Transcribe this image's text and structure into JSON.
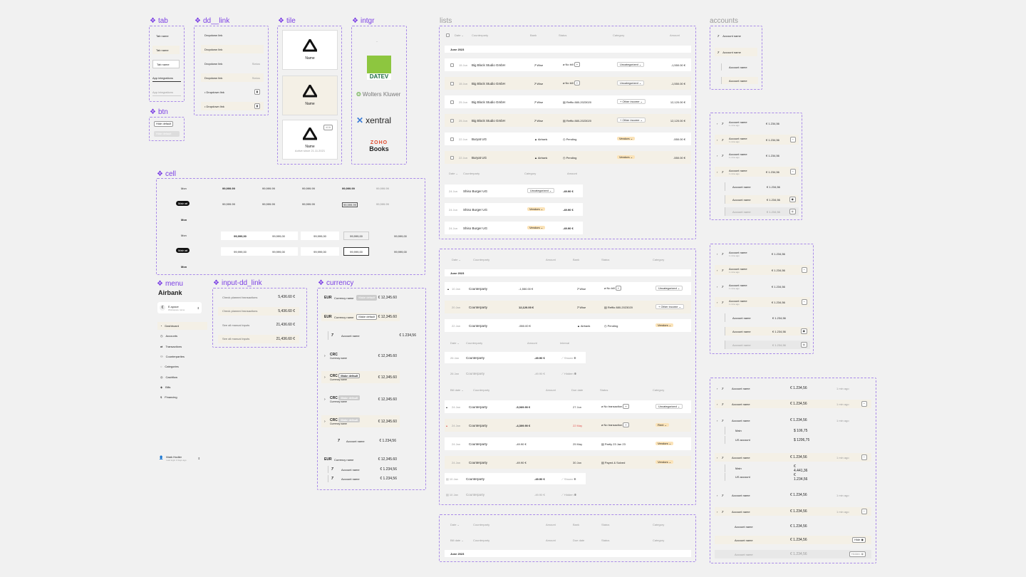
{
  "sections": {
    "tab": "tab",
    "dd_link": "dd__link",
    "tile": "tile",
    "intgr": "intgr",
    "btn": "btn",
    "cell": "cell",
    "menu": "menu",
    "input_dd_link": "input-dd_link",
    "currency": "currency",
    "lists": "lists",
    "accounts": "accounts"
  },
  "colors": {
    "accent": "#7b3fe4",
    "highlight": "#f4f0e6",
    "vendors": "#fbe3b8",
    "datev": "#8dc63f",
    "red": "#e25555"
  },
  "tab": {
    "items": [
      "Tab name",
      "Tab name",
      "Tab name",
      "App integrations",
      "App integrations"
    ]
  },
  "btn": {
    "primary": "Hide default",
    "secondary": "Hide default"
  },
  "dd_link": {
    "items": [
      "Dropdown link",
      "Dropdown link",
      "Dropdown link",
      "Dropdown link",
      "Dropdown link",
      "Dropdown link"
    ],
    "status": "Status"
  },
  "tile": {
    "name": "Name",
    "active_since": "Active since 21.11.2021"
  },
  "intgr": {
    "datev": "DATEV",
    "wolters": "Wolters Kluwer",
    "xentral": "xentral",
    "zoho_top": "ZOHO",
    "zoho_bottom": "Books"
  },
  "cell": {
    "label": "Mon",
    "pill": "Main",
    "value": "99,999.99",
    "big_value": "99,999,00"
  },
  "menu": {
    "logo": "Airbank",
    "workspace": "E-space",
    "workspace_sub": "Workspace name",
    "items": [
      "Dashboard",
      "Accounts",
      "Transactions",
      "Counterparties",
      "Categories",
      "Cashflow",
      "Bills",
      "Financing"
    ],
    "user": "Mark Hodler",
    "user_sub": "Last login 2 days ago"
  },
  "input_dd": {
    "items": [
      {
        "label": "Check planned transactions",
        "value": "5,436.60 €"
      },
      {
        "label": "Check planned transactions",
        "value": "5,436.60 €"
      },
      {
        "label": "See all manual inputs",
        "value": "21,436.60 €"
      },
      {
        "label": "See all manual inputs",
        "value": "21,436.60 €"
      }
    ]
  },
  "currency": {
    "eur": "EUR",
    "crc": "CRC",
    "currency_name": "Currency name",
    "account_name": "Account name",
    "make_default": "Make default",
    "amount": "€ 12,345.60",
    "acc_amount": "€ 1.234,56"
  },
  "lists": {
    "header": {
      "date": "Date",
      "counterparty": "Counterparty",
      "bank": "Bank",
      "status": "Status",
      "category": "Category",
      "amount": "Amount",
      "payment_date": "Payment date",
      "bill_date": "Bill date",
      "due_date": "Due date"
    },
    "month": "June 2023",
    "list1": [
      {
        "date": "15 Jun",
        "name": "Big Block Studio GmbH",
        "bank": "Wise",
        "status": "No bill",
        "category": "Uncategorized",
        "amount": "-1,550.00 €"
      },
      {
        "date": "15 Jun",
        "name": "Big Block Studio GmbH",
        "bank": "Wise",
        "status": "No bill",
        "category": "Uncategorized",
        "amount": "-1,550.00 €"
      },
      {
        "date": "25 Jun",
        "name": "Big Block Studio GmbH",
        "bank": "Wise",
        "status": "Refflo 880-2023020",
        "category": "+ Other income",
        "amount": "12,120.00 €"
      },
      {
        "date": "25 Jun",
        "name": "Big Block Studio GmbH",
        "bank": "Wise",
        "status": "Refflo 880-2023020",
        "category": "+ Other income",
        "amount": "12,120.00 €"
      },
      {
        "date": "22 Jun",
        "name": "Buryat UG",
        "bank": "Airbank",
        "status": "Pending",
        "category": "Vendors",
        "amount": "-550.00 €"
      },
      {
        "date": "22 Jun",
        "name": "Buryat UG",
        "bank": "Airbank",
        "status": "Pending",
        "category": "Vendors",
        "amount": "-550.00 €"
      }
    ],
    "list1b": [
      {
        "date": "24 Jun",
        "name": "Shiso Burger UG",
        "category": "Uncategorized",
        "amount": "-49.90 €"
      },
      {
        "date": "24 Jun",
        "name": "Shiso Burger UG",
        "category": "Vendors",
        "amount": "-49.90 €"
      },
      {
        "date": "24 Jun",
        "name": "Shiso Burger UG",
        "category": "Vendors",
        "amount": "-49.90 €"
      }
    ],
    "list2": [
      {
        "date": "10 Jan",
        "name": "Counterparty",
        "amount": "-1,550.00 €",
        "bank": "Wise",
        "status": "No bill",
        "category": "Uncategorized"
      },
      {
        "date": "20 Jan",
        "name": "Counterparty",
        "amount": "12,120.00 €",
        "bank": "Wise",
        "status": "Refflo 880-2023020",
        "category": "+ Other income"
      },
      {
        "date": "22 Jan",
        "name": "Counterparty",
        "amount": "-550.00 €",
        "bank": "Airbank",
        "status": "Pending",
        "category": "Vendors"
      }
    ],
    "list2b": [
      {
        "date": "26 Jan",
        "name": "Counterparty",
        "amount": "-49.90 €",
        "interval": "Shown"
      },
      {
        "date": "26 Jan",
        "name": "Counterparty",
        "amount": "-49.90 €",
        "interval": "Hidden"
      }
    ],
    "list2c": [
      {
        "date": "24 Jan",
        "name": "Counterparty",
        "amount": "-5,069.90 €",
        "due": "27 Jun",
        "status": "No transaction",
        "category": "Uncategorized"
      },
      {
        "date": "24 Jan",
        "name": "Counterparty",
        "amount": "-4,309.90 €",
        "due": "22 May",
        "status": "No transaction",
        "category": "Rent"
      },
      {
        "date": "24 Jan",
        "name": "Counterparty",
        "amount": "-49.90 €",
        "due": "25 May",
        "status": "Partly 23 Jan 23",
        "category": "Vendors"
      },
      {
        "date": "24 Jan",
        "name": "Counterparty",
        "amount": "-49.90 €",
        "due": "30 Jan",
        "status": "Payed & Solved",
        "category": "Vendors"
      }
    ],
    "list2d": [
      {
        "date": "10 Jan",
        "name": "Counterparty",
        "amount": "-49.90 €",
        "interval": "Shown"
      },
      {
        "date": "10 Jan",
        "name": "Counterparty",
        "amount": "-49.90 €",
        "interval": "Hidden"
      }
    ],
    "interval": "Interval"
  },
  "accounts": {
    "account_name": "Account name",
    "amount": "€ 1.234,56",
    "sub": "1 mina ago",
    "time": "1 min ago",
    "main": "Main",
    "us_account": "US account",
    "v1": "$ 106,75",
    "v2": "$ 1206,75",
    "v3": "€ 4.441,36",
    "v4": "€ 1.234,56",
    "hide": "Hide",
    "hidden": "Hidden"
  }
}
